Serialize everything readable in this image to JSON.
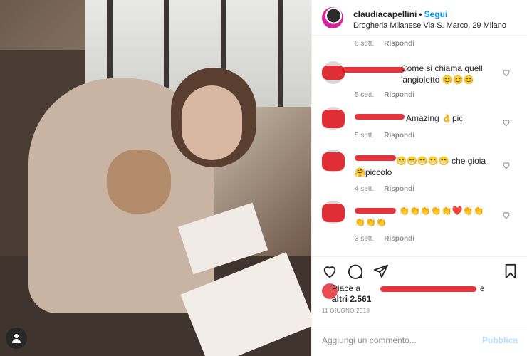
{
  "post": {
    "username": "claudiacapellini",
    "follow_label": "Segui",
    "location": "Drogheria Milanese Via S. Marco, 29 Milano"
  },
  "comments": [
    {
      "text": "",
      "time": "6 sett.",
      "reply": "Rispondi"
    },
    {
      "text": "Come si chiama quell 'angioletto 😊😊😊",
      "time": "5 sett.",
      "reply": "Rispondi"
    },
    {
      "text": "Amazing 👌pic",
      "time": "5 sett.",
      "reply": "Rispondi"
    },
    {
      "text": "😁😁😁😁😁 che gioia 🤗piccolo",
      "time": "4 sett.",
      "reply": "Rispondi"
    },
    {
      "text": "👏👏👏👏👏❤️👏👏👏👏👏",
      "time": "3 sett.",
      "reply": "Rispondi"
    }
  ],
  "likes": {
    "prefix": "Piace a",
    "suffix": "e",
    "text": "altri 2.561"
  },
  "date": "11 GIUGNO 2018",
  "add_comment": {
    "placeholder": "Aggiungi un commento...",
    "publish": "Pubblica"
  },
  "icons": {
    "like": "heart-icon",
    "comment": "comment-icon",
    "share": "share-icon",
    "save": "bookmark-icon",
    "tag": "user-tag-icon"
  },
  "colors": {
    "accent": "#0095f6",
    "redaction": "#e0101a",
    "muted": "#8e8e8e"
  }
}
